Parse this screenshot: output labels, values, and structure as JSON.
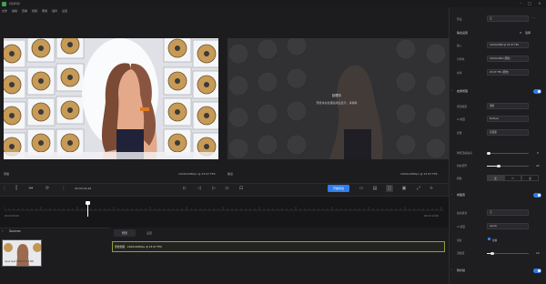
{
  "window": {
    "title": "视频转换"
  },
  "menu": [
    "文件",
    "编辑",
    "查看",
    "视频",
    "帮助",
    "插件",
    "设置"
  ],
  "preview": {
    "left_label": "原始",
    "left_info": "1920x1080px @ 23.97 FPS",
    "right_label": "输出",
    "right_info": "1920x1080px @ 23.97 FPS",
    "process_title": "处理中",
    "process_sub": "预览将在处理完成后显示，请稍候"
  },
  "toolbar": {
    "timecode": "00:00:04;26",
    "export_label": "开始导出"
  },
  "timeline": {
    "start_time": "00:00:00;00",
    "end_time": "00:02:12;08"
  },
  "sources": {
    "label": "Sources",
    "thumb_caption": "Aqua.mp4  0000(H) 5.3 MB"
  },
  "tabs": [
    "预览",
    "设置"
  ],
  "selection": {
    "text": "原始视频 · 1920x1080px @ 23.97 FPS"
  },
  "panel": {
    "preset_label": "预设",
    "preset_value": "无",
    "section_output": "输出设置",
    "section_output_right": "选择",
    "out_rows": [
      {
        "label": "输入",
        "value": "1920x1080 @ 23.97 FPS"
      },
      {
        "label": "分辨率",
        "value": "1920x1080 (原始)"
      },
      {
        "label": "帧率",
        "value": "23.97 FPS (原始)"
      }
    ],
    "section_enhance": "启用增强",
    "enh_rows": [
      {
        "label": "增强模型",
        "value": "通用"
      },
      {
        "label": "AI 模型",
        "value": "Proteus"
      },
      {
        "label": "质量",
        "value": "高质量"
      }
    ],
    "adj1_label": "降低压缩失真",
    "adj1_value": "0",
    "adj2_label": "恢复细节",
    "adj2_value": "20",
    "grain_label": "颗粒",
    "grain_opts": [
      "无",
      "少",
      "多"
    ],
    "section_frame": "帧插值",
    "frame_rows": [
      {
        "label": "插帧模式",
        "value": "无"
      },
      {
        "label": "AI 模型",
        "value": "Apollo"
      },
      {
        "label": "重复",
        "value": "替换"
      },
      {
        "label": "灵敏度",
        "value": "10"
      }
    ],
    "section_stab": "防抖动"
  },
  "accent": "#2f7ef0",
  "selection_color": "#8aa238"
}
